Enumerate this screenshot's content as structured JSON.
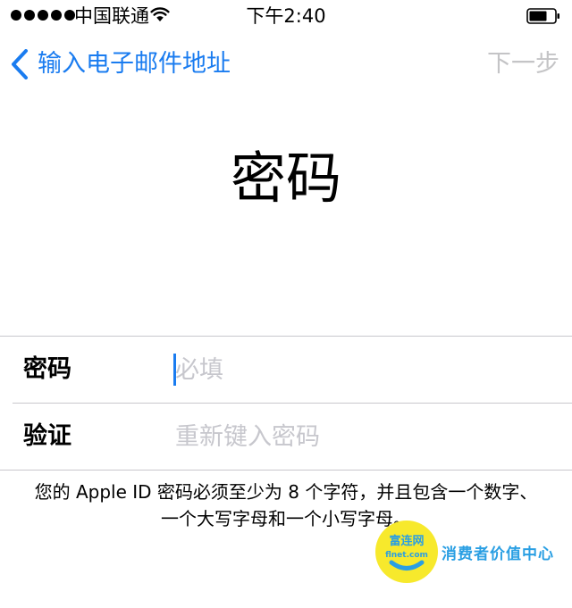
{
  "status_bar": {
    "carrier": "中国联通",
    "time": "下午2:40",
    "signal_bars": 5
  },
  "nav": {
    "back_label": "输入电子邮件地址",
    "next_label": "下一步"
  },
  "title": "密码",
  "form": {
    "password": {
      "label": "密码",
      "placeholder": "必填",
      "value": ""
    },
    "verify": {
      "label": "验证",
      "placeholder": "重新键入密码",
      "value": ""
    }
  },
  "hint": "您的 Apple ID 密码必须至少为 8 个字符，并且包含一个数字、一个大写字母和一个小写字母。",
  "watermark": {
    "logo_text": "富连网",
    "logo_domain": "flnet.com",
    "caption": "消费者价值中心"
  },
  "colors": {
    "accent": "#1a7cf0",
    "disabled": "#c4c4c6",
    "placeholder": "#c7c7cd",
    "separator": "#c8c7cc"
  }
}
